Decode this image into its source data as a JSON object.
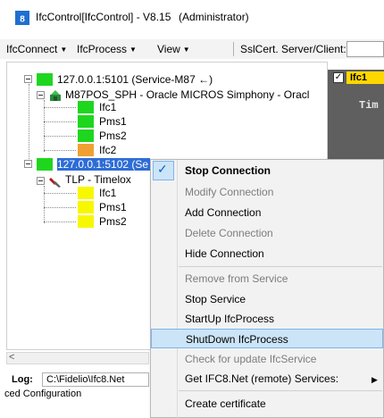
{
  "window": {
    "title": "IfcControl[IfcControl] - V8.15",
    "admin": "(Administrator)"
  },
  "menu": {
    "items": [
      "IfcConnect",
      "IfcProcess",
      "View",
      "SslCert. Server/Client:"
    ]
  },
  "tree": {
    "connections": [
      {
        "label": "127.0.0.1:5101 (Service-M87 ←)",
        "status_color": "#1fd61f",
        "host": "M87POS_SPH - Oracle MICROS Simphony - Oracl",
        "channels": [
          {
            "label": "Ifc1",
            "color": "#1fd61f"
          },
          {
            "label": "Pms1",
            "color": "#1fd61f"
          },
          {
            "label": "Pms2",
            "color": "#1fd61f"
          },
          {
            "label": "Ifc2",
            "color": "#f0a030"
          }
        ]
      },
      {
        "label": "127.0.0.1:5102 (Se",
        "status_color": "#1fd61f",
        "host": "TLP - Timelox",
        "channels": [
          {
            "label": "Ifc1",
            "color": "#f7f700"
          },
          {
            "label": "Pms1",
            "color": "#f7f700"
          },
          {
            "label": "Pms2",
            "color": "#f7f700"
          }
        ]
      }
    ]
  },
  "log": {
    "label": "Log:",
    "path": "C:\\Fidelio\\Ifc8.Net"
  },
  "bottom_text": "ced Configuration",
  "right_panel": {
    "checked": true,
    "label": "Ifc1",
    "title": "Tim"
  },
  "context_menu": {
    "items": [
      {
        "label": "Stop Connection",
        "bold": true,
        "enabled": true,
        "checked": true
      },
      {
        "label": "Modify Connection",
        "enabled": false
      },
      {
        "label": "Add Connection",
        "enabled": true
      },
      {
        "label": "Delete Connection",
        "enabled": false
      },
      {
        "label": "Hide Connection",
        "enabled": true
      },
      {
        "label": "Remove from Service",
        "enabled": false
      },
      {
        "label": "Stop Service",
        "enabled": true
      },
      {
        "label": "StartUp IfcProcess",
        "enabled": true
      },
      {
        "label": "ShutDown IfcProcess",
        "enabled": true,
        "highlighted": true
      },
      {
        "label": "Check for update IfcService",
        "enabled": false
      },
      {
        "label": "Get IFC8.Net (remote) Services:",
        "enabled": true,
        "submenu": true
      },
      {
        "label": "Create certificate",
        "enabled": true
      }
    ]
  },
  "colors": {
    "ok": "#1fd61f",
    "warn": "#f0a030",
    "pending": "#f7f700",
    "selection": "#2e6dd6",
    "menu_highlight": "#cce4f7"
  }
}
